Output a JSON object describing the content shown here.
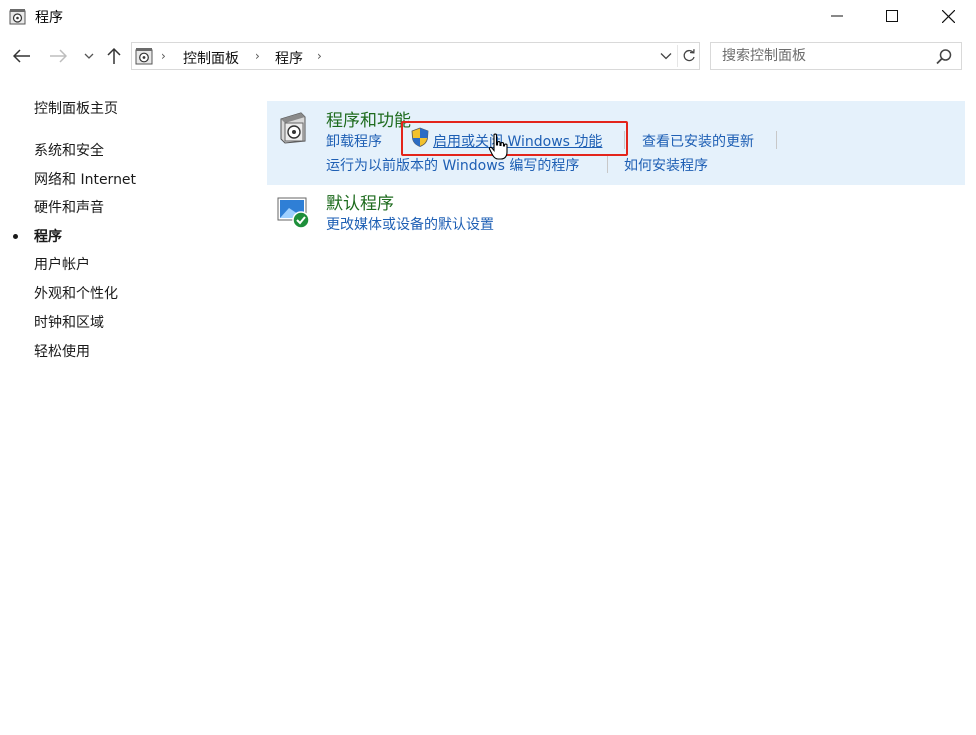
{
  "window": {
    "title": "程序",
    "minimize_glyph": "—",
    "maximize_glyph": "☐",
    "close_glyph": "✕"
  },
  "nav": {
    "breadcrumbs": [
      "控制面板",
      "程序"
    ],
    "search_placeholder": "搜索控制面板"
  },
  "sidebar": {
    "home": "控制面板主页",
    "items": [
      {
        "label": "系统和安全"
      },
      {
        "label": "网络和 Internet"
      },
      {
        "label": "硬件和声音"
      },
      {
        "label": "程序",
        "active": true
      },
      {
        "label": "用户帐户"
      },
      {
        "label": "外观和个性化"
      },
      {
        "label": "时钟和区域"
      },
      {
        "label": "轻松使用"
      }
    ]
  },
  "main": {
    "categories": [
      {
        "title": "程序和功能",
        "links_row1": [
          "卸载程序",
          "启用或关闭 Windows 功能",
          "查看已安装的更新"
        ],
        "links_row2": [
          "运行为以前版本的 Windows 编写的程序",
          "如何安装程序"
        ]
      },
      {
        "title": "默认程序",
        "links_row1": [
          "更改媒体或设备的默认设置"
        ]
      }
    ]
  },
  "colors": {
    "category_title": "#1e6b1e",
    "link": "#1e5fb4",
    "highlight_bg": "#e5f1fb",
    "annotation_box": "#e3241b"
  }
}
